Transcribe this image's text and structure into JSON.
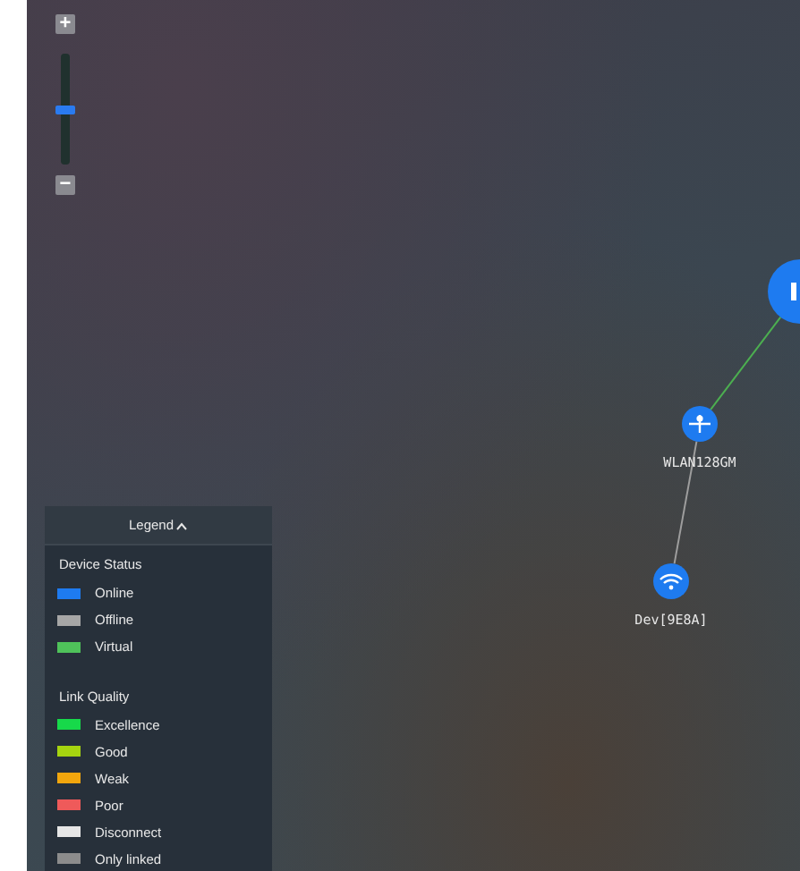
{
  "zoom_control": {
    "plus": "+",
    "minus": "−",
    "level": 0.5
  },
  "topology": {
    "nodes": [
      {
        "kind": "router"
      },
      {
        "kind": "mesh",
        "label": "WLAN128GM"
      },
      {
        "kind": "wifi",
        "label": "Dev[9E8A]"
      }
    ],
    "links": [
      {
        "color": "#4caf50"
      },
      {
        "color": "#9e9e9e"
      }
    ]
  },
  "legend": {
    "title": "Legend",
    "expanded": true,
    "sections": [
      {
        "heading": "Device Status",
        "items": [
          {
            "label": "Online",
            "color": "#1e7bf0"
          },
          {
            "label": "Offline",
            "color": "#a6a6a6"
          },
          {
            "label": "Virtual",
            "color": "#4fc25a"
          }
        ]
      },
      {
        "heading": "Link Quality",
        "items": [
          {
            "label": "Excellence",
            "color": "#17d94a"
          },
          {
            "label": "Good",
            "color": "#a6d40f"
          },
          {
            "label": "Weak",
            "color": "#f2a60d"
          },
          {
            "label": "Poor",
            "color": "#ef5a5a"
          },
          {
            "label": "Disconnect",
            "color": "#e6e6e6"
          },
          {
            "label": "Only linked",
            "color": "#8c8c8c"
          }
        ]
      }
    ]
  }
}
